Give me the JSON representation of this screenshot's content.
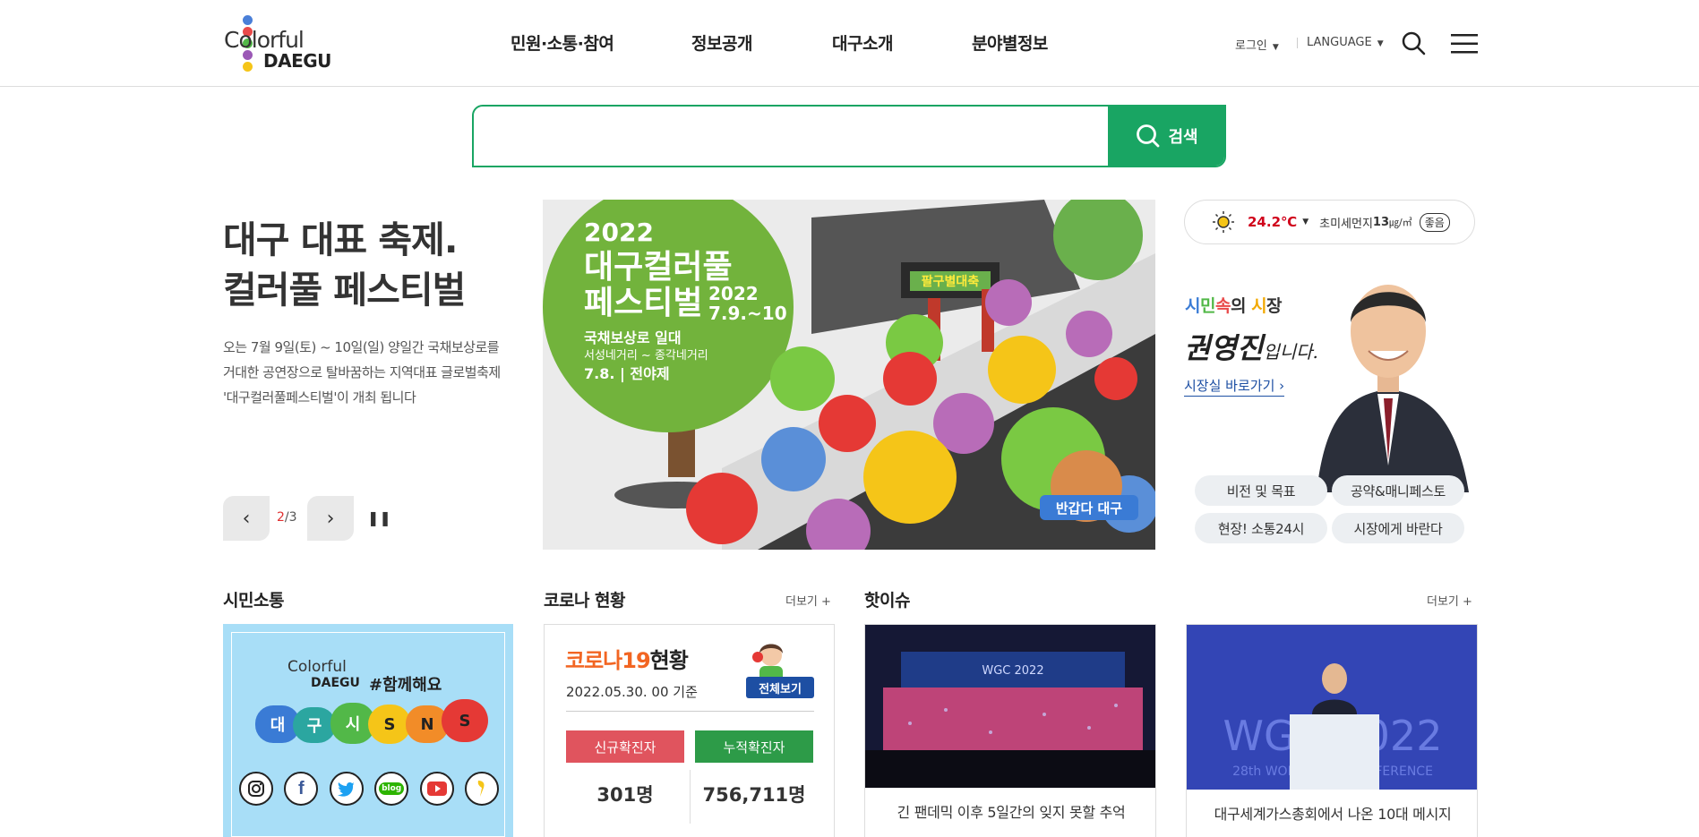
{
  "header": {
    "logo_line1": "Colorful",
    "logo_line2": "DAEGU",
    "nav": [
      "민원·소통·참여",
      "정보공개",
      "대구소개",
      "분야별정보"
    ],
    "login": "로그인",
    "language": "LANGUAGE"
  },
  "search": {
    "placeholder": "",
    "button_label": "검색"
  },
  "hero": {
    "title_line1": "대구 대표 축제.",
    "title_line2": "컬러풀 페스티벌",
    "desc": "오는 7월 9일(토) ~ 10일(일) 양일간 국채보상로를 거대한 공연장으로 탈바꿈하는 지역대표 글로벌축제 '대구컬러풀페스티벌'이 개최 됩니다",
    "page_current": "2",
    "page_total": "/3"
  },
  "banner": {
    "year": "2022",
    "title_line1": "대구컬러풀",
    "title_line2": "페스티벌",
    "date_year": "2022",
    "date": "7.9.~10",
    "place": "국채보상로 일대",
    "place_sub": "서성네거리 ~ 종각네거리",
    "eve": "7.8. | 전야제",
    "gate_sign": "팔구별대축",
    "mascot_tag": "반갑다 대구"
  },
  "weather": {
    "temp": "24.2℃",
    "dust_label": "초미세먼지",
    "dust_value": "13",
    "dust_unit": "㎍/㎥",
    "dust_status": "좋음"
  },
  "mayor": {
    "slogan_parts": [
      "시",
      "민",
      "속",
      "의 ",
      "시",
      "장"
    ],
    "name": "권영진",
    "name_suffix": "입니다.",
    "link": "시장실 바로가기",
    "buttons": [
      "비전 및 목표",
      "공약&매니페스토",
      "현장! 소통24시",
      "시장에게 바란다"
    ]
  },
  "sections": {
    "citizen": {
      "title": "시민소통",
      "logo1": "Colorful",
      "logo2": "DAEGU",
      "hashtag": "#함께해요",
      "sns_letters": [
        "대",
        "구",
        "시",
        "S",
        "N",
        "S"
      ],
      "sns_icons": [
        "instagram-icon",
        "facebook-icon",
        "twitter-icon",
        "blog-icon",
        "youtube-icon",
        "kakao-story-icon"
      ],
      "blog_text": "blog"
    },
    "corona": {
      "title": "코로나 현황",
      "more": "더보기 +",
      "card_title_a": "코로나19",
      "card_title_b": "현황",
      "date": "2022.05.30. 00 기준",
      "view_all": "전체보기",
      "new_label": "신규확진자",
      "total_label": "누적확진자",
      "new_value": "301명",
      "total_value": "756,711명"
    },
    "hot": {
      "title": "핫이슈",
      "more": "더보기 +",
      "items": [
        {
          "caption": "긴 팬데믹 이후 5일간의 잊지 못할 추억",
          "screen_text": "WGC 2022"
        },
        {
          "caption": "대구세계가스총회에서 나온 10대 메시지",
          "screen_text": "WGC 2022",
          "screen_sub": "28th WORLD GAS CONFERENCE"
        }
      ]
    }
  },
  "colors": {
    "accent_green": "#19a563",
    "new_red": "#e0545e",
    "total_green": "#2d9b48",
    "temp_red": "#d0021b",
    "corona_orange": "#f26522"
  }
}
